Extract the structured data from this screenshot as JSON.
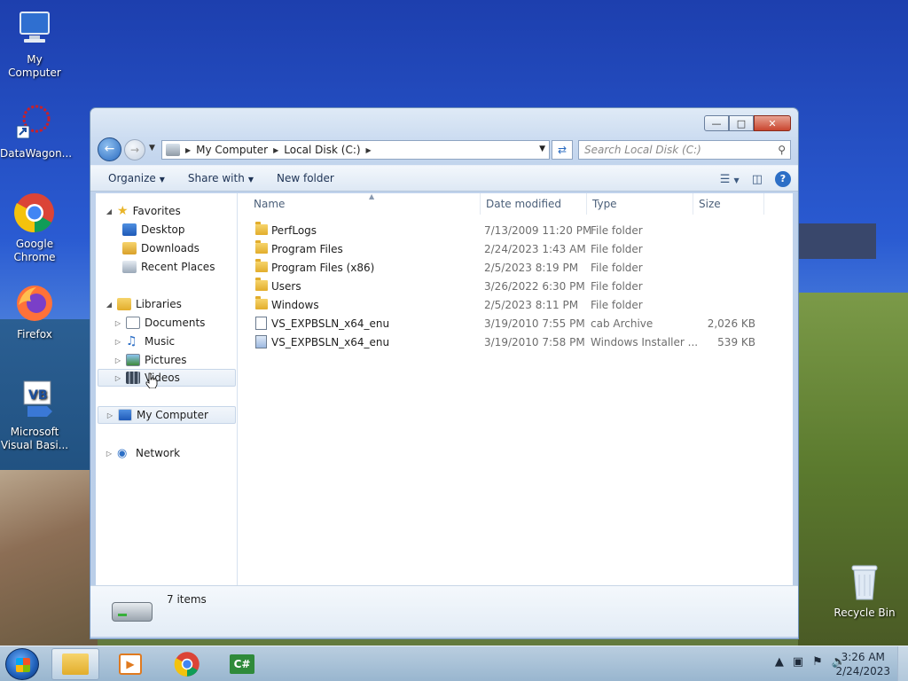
{
  "desktop": {
    "icons": [
      {
        "label": "My Computer"
      },
      {
        "label": "DataWagon..."
      },
      {
        "label": "Google Chrome"
      },
      {
        "label": "Firefox"
      },
      {
        "label": "Microsoft Visual Basi..."
      },
      {
        "label": "Recycle Bin"
      }
    ]
  },
  "window": {
    "controls": {
      "minimize": "—",
      "maximize": "□",
      "close": "✕"
    },
    "address": {
      "crumbs": [
        "My Computer",
        "Local Disk (C:)"
      ]
    },
    "search_placeholder": "Search Local Disk (C:)",
    "toolbar": {
      "organize": "Organize",
      "share_with": "Share with",
      "new_folder": "New folder"
    },
    "nav": {
      "favorites": "Favorites",
      "desktop": "Desktop",
      "downloads": "Downloads",
      "recent_places": "Recent Places",
      "libraries": "Libraries",
      "documents": "Documents",
      "music": "Music",
      "pictures": "Pictures",
      "videos": "Videos",
      "my_computer": "My Computer",
      "network": "Network"
    },
    "columns": {
      "name": "Name",
      "date_modified": "Date modified",
      "type": "Type",
      "size": "Size"
    },
    "files": [
      {
        "name": "PerfLogs",
        "date": "7/13/2009 11:20 PM",
        "type": "File folder",
        "size": ""
      },
      {
        "name": "Program Files",
        "date": "2/24/2023 1:43 AM",
        "type": "File folder",
        "size": ""
      },
      {
        "name": "Program Files (x86)",
        "date": "2/5/2023 8:19 PM",
        "type": "File folder",
        "size": ""
      },
      {
        "name": "Users",
        "date": "3/26/2022 6:30 PM",
        "type": "File folder",
        "size": ""
      },
      {
        "name": "Windows",
        "date": "2/5/2023 8:11 PM",
        "type": "File folder",
        "size": ""
      },
      {
        "name": "VS_EXPBSLN_x64_enu",
        "date": "3/19/2010 7:55 PM",
        "type": "cab Archive",
        "size": "2,026 KB"
      },
      {
        "name": "VS_EXPBSLN_x64_enu",
        "date": "3/19/2010 7:58 PM",
        "type": "Windows Installer ...",
        "size": "539 KB"
      }
    ],
    "details": {
      "items_count": "7 items"
    }
  },
  "taskbar": {
    "clock_time": "3:26 AM",
    "clock_date": "2/24/2023"
  }
}
